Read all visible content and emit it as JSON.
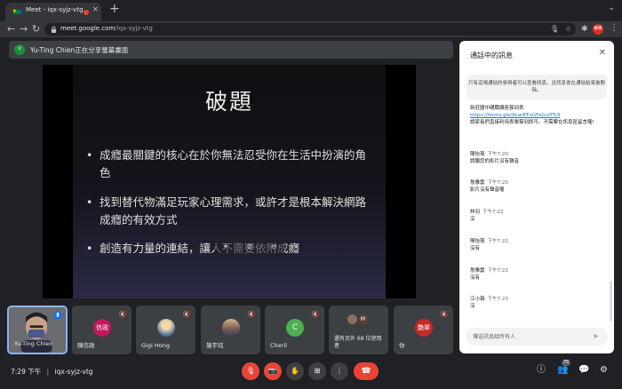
{
  "browser": {
    "tab_title": "Meet - iqx-syjz-vtg",
    "tab_close": "✕",
    "new_tab": "+",
    "url_host": "meet.google.com",
    "url_path": "/iqx-syjz-vtg",
    "profile_initials": "繼暢",
    "icons": [
      "back-icon",
      "forward-icon",
      "reload-icon",
      "lock-icon",
      "mic-icon",
      "camera-icon",
      "star-icon",
      "extensions-icon",
      "reading-list-icon"
    ]
  },
  "presentation": {
    "banner_initial": "Y",
    "banner_text": "Yu-Ting Chien正在分享螢幕畫面",
    "slide_title": "破題",
    "bullets": [
      "成癮最關鍵的核心在於你無法忍受你在生活中扮演的角色",
      "找到替代物滿足玩家心理需求，或許才是根本解決網路成癮的有效方式",
      "創造有力量的連結，讓人不需要依附成癮"
    ]
  },
  "participants": [
    {
      "name": "Yu-Ting Chien",
      "self": true
    },
    {
      "name": "陳信政",
      "avatar_text": "信政",
      "color": "#c2185b"
    },
    {
      "name": "Gigi Hong",
      "avatar_text": "",
      "color": "#4a6fa5"
    },
    {
      "name": "施宇珏",
      "avatar_text": "",
      "color": "#7b5e57"
    },
    {
      "name": "Cheril",
      "avatar_text": "C",
      "color": "#4caf50"
    },
    {
      "name": "還有另外 68 位使用者",
      "avatar_text": "M",
      "color": "#5d4037"
    },
    {
      "name": "你",
      "avatar_text": "艷翠",
      "color": "#c62828"
    }
  ],
  "meeting": {
    "time": "7:29 下午",
    "separator": "|",
    "code": "iqx-syjz-vtg",
    "people_count": "75"
  },
  "chat": {
    "title": "通話中的訊息",
    "close": "✕",
    "notice": "只有這場通話的參與者可以查看訊息，且訊息會在通話結束後刪除。",
    "first_message": {
      "line1": "新莊國中親職講座簽到表",
      "link": "https://forms.gle/bLwiEFxGFeGuHTc9",
      "line3": "請家長們直接利用表單簽到即可。不需要在訊息區留言喔!"
    },
    "messages": [
      {
        "sender": "陳怡蒨",
        "time": "下午7:20",
        "text": "請聽您的影片沒有聲音"
      },
      {
        "sender": "詹雅雲",
        "time": "下午7:20",
        "text": "影片沒有聲音喔"
      },
      {
        "sender": "林羽",
        "time": "下午7:22",
        "text": "沒"
      },
      {
        "sender": "陳怡蒨",
        "time": "下午7:22",
        "text": "沒有"
      },
      {
        "sender": "詹雅雲",
        "time": "下午7:22",
        "text": "沒有"
      },
      {
        "sender": "江小薇",
        "time": "下午7:23",
        "text": "沒"
      }
    ],
    "input_placeholder": "傳送訊息給所有人"
  },
  "colors": {
    "background": "#202124",
    "tile": "#3c4043",
    "accent_red": "#ea4335",
    "accent_blue": "#1a73e8"
  }
}
